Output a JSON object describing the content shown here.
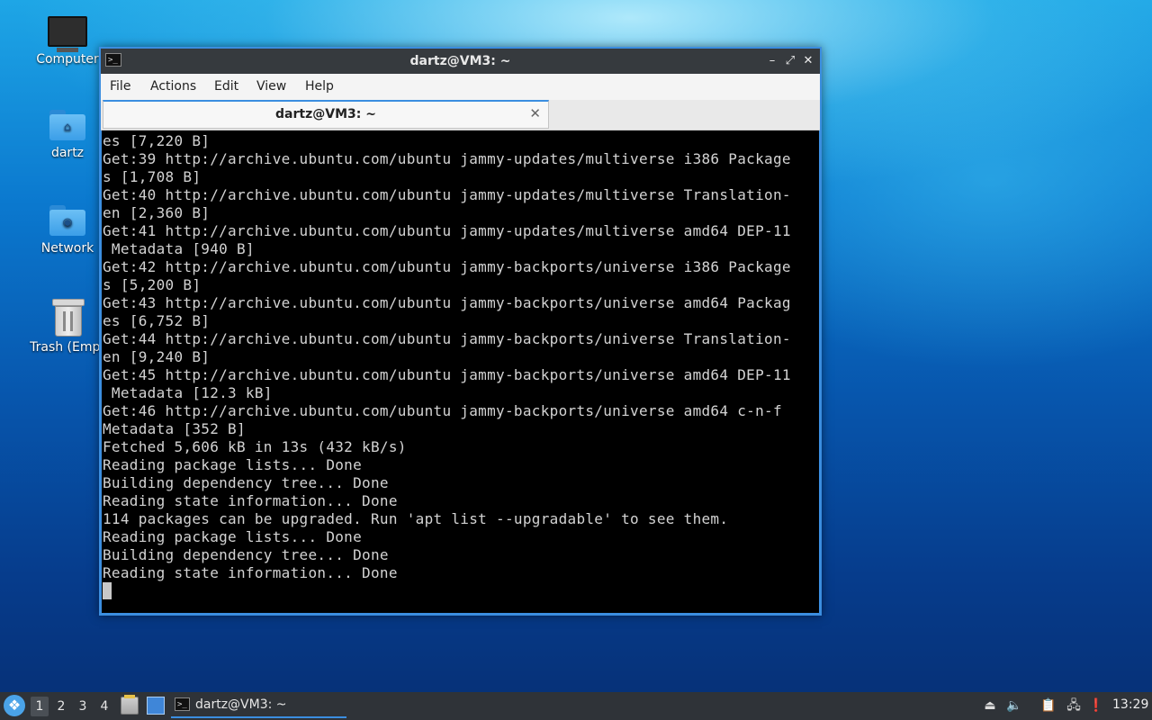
{
  "desktop": {
    "icons": [
      {
        "label": "Computer"
      },
      {
        "label": "dartz"
      },
      {
        "label": "Network"
      },
      {
        "label": "Trash (Empt"
      }
    ]
  },
  "window": {
    "title": "dartz@VM3: ~",
    "controls": {
      "minimize": "–",
      "maximize": "⤢",
      "close": "✕"
    },
    "menu": [
      "File",
      "Actions",
      "Edit",
      "View",
      "Help"
    ],
    "tab": {
      "label": "dartz@VM3: ~",
      "close": "✕"
    },
    "terminal_output": "es [7,220 B]\nGet:39 http://archive.ubuntu.com/ubuntu jammy-updates/multiverse i386 Package\ns [1,708 B]\nGet:40 http://archive.ubuntu.com/ubuntu jammy-updates/multiverse Translation-\nen [2,360 B]\nGet:41 http://archive.ubuntu.com/ubuntu jammy-updates/multiverse amd64 DEP-11\n Metadata [940 B]\nGet:42 http://archive.ubuntu.com/ubuntu jammy-backports/universe i386 Package\ns [5,200 B]\nGet:43 http://archive.ubuntu.com/ubuntu jammy-backports/universe amd64 Packag\nes [6,752 B]\nGet:44 http://archive.ubuntu.com/ubuntu jammy-backports/universe Translation-\nen [9,240 B]\nGet:45 http://archive.ubuntu.com/ubuntu jammy-backports/universe amd64 DEP-11\n Metadata [12.3 kB]\nGet:46 http://archive.ubuntu.com/ubuntu jammy-backports/universe amd64 c-n-f\nMetadata [352 B]\nFetched 5,606 kB in 13s (432 kB/s)\nReading package lists... Done\nBuilding dependency tree... Done\nReading state information... Done\n114 packages can be upgraded. Run 'apt list --upgradable' to see them.\nReading package lists... Done\nBuilding dependency tree... Done\nReading state information... Done"
  },
  "taskbar": {
    "workspaces": [
      "1",
      "2",
      "3",
      "4"
    ],
    "active_workspace": "1",
    "task": {
      "label": "dartz@VM3: ~"
    },
    "clock": "13:29"
  },
  "colors": {
    "accent": "#3b8ee0",
    "titlebar": "#363a3e",
    "taskbar": "#2f3338",
    "terminal_bg": "#000000",
    "terminal_fg": "#d3d3d3"
  }
}
